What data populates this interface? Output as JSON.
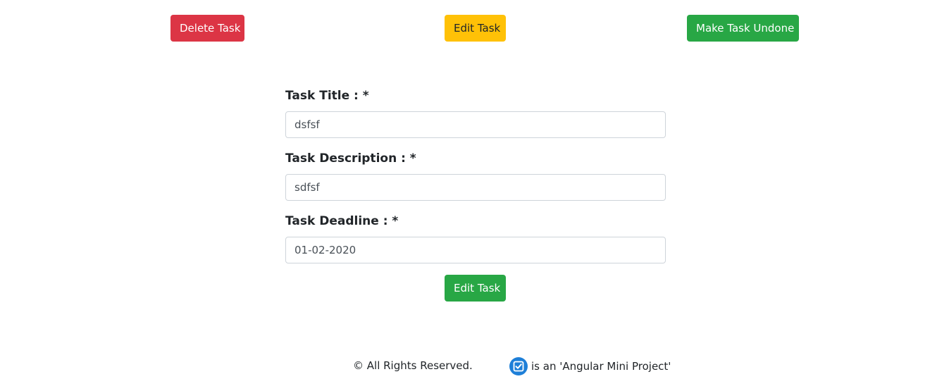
{
  "toolbar": {
    "delete_label": "Delete Task",
    "edit_label": "Edit Task",
    "undone_label": "Make Task Undone"
  },
  "form": {
    "title_label": "Task Title : *",
    "title_value": "dsfsf",
    "description_label": "Task Description : *",
    "description_value": "sdfsf",
    "deadline_label": "Task Deadline : *",
    "deadline_value": "01-02-2020",
    "submit_label": "Edit Task"
  },
  "footer": {
    "rights": "© All Rights Reserved.",
    "project_text": "is an 'Angular Mini Project'",
    "logo_icon": "checkbox-logo-icon"
  },
  "colors": {
    "danger": "#dc3545",
    "warning": "#ffc107",
    "success": "#28a745",
    "logo": "#1e7fd8"
  }
}
